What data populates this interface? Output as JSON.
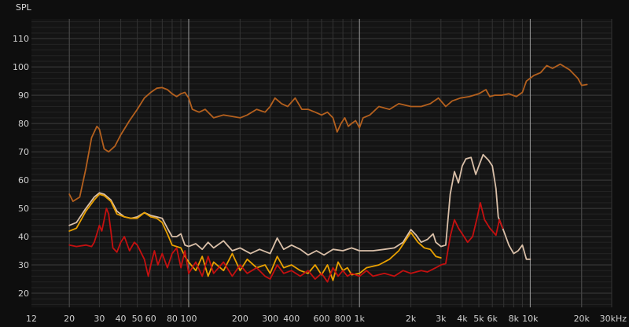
{
  "chart_data": {
    "type": "line",
    "ylabel": "SPL",
    "xscale": "log",
    "xlim": [
      12,
      30000
    ],
    "ylim": [
      15,
      117
    ],
    "grid": true,
    "yticks": [
      20,
      30,
      40,
      50,
      60,
      70,
      80,
      90,
      100,
      110
    ],
    "ytick_labels": [
      "20",
      "30",
      "40",
      "50",
      "60",
      "70",
      "80",
      "90",
      "100",
      "110"
    ],
    "xticks": [
      12,
      20,
      30,
      40,
      50,
      60,
      80,
      100,
      200,
      300,
      400,
      600,
      800,
      1000,
      2000,
      3000,
      4000,
      5000,
      6000,
      8000,
      10000,
      20000,
      30000
    ],
    "xtick_labels": [
      "12",
      "20",
      "30",
      "40",
      "50",
      "60",
      "80",
      "100",
      "200",
      "300",
      "400",
      "600",
      "800",
      "1k",
      "2k",
      "3k",
      "4k",
      "5k",
      "6k",
      "8k",
      "10k",
      "20k",
      "30kHz"
    ],
    "series": [
      {
        "color": "#b4601e",
        "points": [
          [
            20,
            55
          ],
          [
            21,
            52.5
          ],
          [
            23,
            54
          ],
          [
            25,
            64
          ],
          [
            27,
            75
          ],
          [
            29,
            79
          ],
          [
            30,
            78
          ],
          [
            32,
            71
          ],
          [
            34,
            70
          ],
          [
            37,
            72
          ],
          [
            40,
            76
          ],
          [
            45,
            81
          ],
          [
            50,
            85
          ],
          [
            55,
            89
          ],
          [
            60,
            91
          ],
          [
            65,
            92.5
          ],
          [
            70,
            92.7
          ],
          [
            75,
            92
          ],
          [
            80,
            90.5
          ],
          [
            85,
            89.5
          ],
          [
            90,
            90.5
          ],
          [
            95,
            91
          ],
          [
            100,
            89
          ],
          [
            105,
            85
          ],
          [
            115,
            84
          ],
          [
            125,
            85
          ],
          [
            140,
            82
          ],
          [
            160,
            83
          ],
          [
            180,
            82.5
          ],
          [
            200,
            82
          ],
          [
            220,
            83
          ],
          [
            250,
            85
          ],
          [
            280,
            84
          ],
          [
            300,
            86
          ],
          [
            320,
            89
          ],
          [
            350,
            87
          ],
          [
            380,
            86
          ],
          [
            420,
            89
          ],
          [
            460,
            85
          ],
          [
            500,
            85
          ],
          [
            550,
            84
          ],
          [
            600,
            83
          ],
          [
            650,
            84
          ],
          [
            700,
            82
          ],
          [
            740,
            77
          ],
          [
            780,
            80
          ],
          [
            820,
            82
          ],
          [
            860,
            79
          ],
          [
            900,
            80
          ],
          [
            950,
            81
          ],
          [
            1000,
            78.5
          ],
          [
            1050,
            82
          ],
          [
            1150,
            83
          ],
          [
            1300,
            86
          ],
          [
            1500,
            85
          ],
          [
            1700,
            87
          ],
          [
            2000,
            86
          ],
          [
            2300,
            86
          ],
          [
            2600,
            87
          ],
          [
            2900,
            89
          ],
          [
            3200,
            86
          ],
          [
            3500,
            88
          ],
          [
            3900,
            89
          ],
          [
            4400,
            89.5
          ],
          [
            5000,
            90.5
          ],
          [
            5500,
            92
          ],
          [
            5800,
            89.5
          ],
          [
            6200,
            90
          ],
          [
            6800,
            90
          ],
          [
            7500,
            90.5
          ],
          [
            8300,
            89.5
          ],
          [
            9000,
            91
          ],
          [
            9500,
            95
          ],
          [
            10500,
            97
          ],
          [
            11500,
            98
          ],
          [
            12500,
            100.5
          ],
          [
            13500,
            99.5
          ],
          [
            15000,
            101
          ],
          [
            17000,
            99
          ],
          [
            19000,
            96
          ],
          [
            20000,
            93.5
          ],
          [
            21500,
            93.8
          ]
        ]
      },
      {
        "color": "#d9bfa8",
        "points": [
          [
            20,
            44
          ],
          [
            22,
            45
          ],
          [
            25,
            50
          ],
          [
            28,
            54
          ],
          [
            30,
            55.5
          ],
          [
            32,
            55
          ],
          [
            35,
            53
          ],
          [
            38,
            49
          ],
          [
            42,
            47
          ],
          [
            46,
            46.5
          ],
          [
            50,
            47
          ],
          [
            55,
            48.5
          ],
          [
            60,
            47.5
          ],
          [
            65,
            47
          ],
          [
            70,
            46.5
          ],
          [
            75,
            43
          ],
          [
            80,
            40
          ],
          [
            85,
            40
          ],
          [
            90,
            41
          ],
          [
            95,
            37
          ],
          [
            100,
            36.5
          ],
          [
            110,
            37.5
          ],
          [
            120,
            35.5
          ],
          [
            130,
            38
          ],
          [
            140,
            36
          ],
          [
            160,
            38.5
          ],
          [
            180,
            35
          ],
          [
            200,
            36
          ],
          [
            230,
            34
          ],
          [
            260,
            35.5
          ],
          [
            300,
            34
          ],
          [
            330,
            39.5
          ],
          [
            360,
            35.5
          ],
          [
            400,
            37
          ],
          [
            450,
            35.5
          ],
          [
            500,
            33.5
          ],
          [
            560,
            35
          ],
          [
            620,
            33.5
          ],
          [
            700,
            35.5
          ],
          [
            800,
            35
          ],
          [
            900,
            36
          ],
          [
            1000,
            35
          ],
          [
            1200,
            35
          ],
          [
            1400,
            35.5
          ],
          [
            1600,
            36
          ],
          [
            1800,
            38
          ],
          [
            2000,
            42.5
          ],
          [
            2150,
            40.5
          ],
          [
            2300,
            38
          ],
          [
            2500,
            39
          ],
          [
            2700,
            41
          ],
          [
            2800,
            38
          ],
          [
            3000,
            36.5
          ],
          [
            3200,
            37
          ],
          [
            3400,
            55
          ],
          [
            3600,
            63
          ],
          [
            3800,
            59
          ],
          [
            4000,
            65
          ],
          [
            4200,
            67.5
          ],
          [
            4500,
            68
          ],
          [
            4800,
            62
          ],
          [
            5000,
            65
          ],
          [
            5300,
            69
          ],
          [
            5700,
            67
          ],
          [
            6000,
            65
          ],
          [
            6300,
            57
          ],
          [
            6500,
            47
          ],
          [
            7000,
            42
          ],
          [
            7500,
            37
          ],
          [
            8000,
            34
          ],
          [
            8500,
            35
          ],
          [
            9000,
            37
          ],
          [
            9500,
            32
          ],
          [
            10000,
            32
          ]
        ]
      },
      {
        "color": "#e8a000",
        "points": [
          [
            20,
            42
          ],
          [
            22,
            43
          ],
          [
            25,
            49
          ],
          [
            28,
            53
          ],
          [
            30,
            55
          ],
          [
            32,
            54.5
          ],
          [
            35,
            52.5
          ],
          [
            38,
            48
          ],
          [
            42,
            47
          ],
          [
            46,
            46.5
          ],
          [
            50,
            46.5
          ],
          [
            55,
            48.5
          ],
          [
            60,
            47
          ],
          [
            65,
            46.5
          ],
          [
            70,
            45
          ],
          [
            75,
            41
          ],
          [
            80,
            37
          ],
          [
            90,
            36
          ],
          [
            95,
            33
          ],
          [
            100,
            31
          ],
          [
            110,
            28
          ],
          [
            120,
            33
          ],
          [
            130,
            26
          ],
          [
            140,
            31
          ],
          [
            160,
            28
          ],
          [
            180,
            34
          ],
          [
            200,
            28
          ],
          [
            220,
            32
          ],
          [
            250,
            29
          ],
          [
            280,
            30
          ],
          [
            300,
            27
          ],
          [
            330,
            33
          ],
          [
            360,
            29
          ],
          [
            400,
            30
          ],
          [
            450,
            28
          ],
          [
            500,
            27
          ],
          [
            550,
            30
          ],
          [
            600,
            26.5
          ],
          [
            650,
            30
          ],
          [
            700,
            24.5
          ],
          [
            750,
            31
          ],
          [
            800,
            28
          ],
          [
            850,
            29
          ],
          [
            900,
            26.5
          ],
          [
            1000,
            27
          ],
          [
            1100,
            29
          ],
          [
            1300,
            30
          ],
          [
            1500,
            32
          ],
          [
            1700,
            35
          ],
          [
            2000,
            41.5
          ],
          [
            2200,
            38
          ],
          [
            2400,
            36
          ],
          [
            2600,
            35.5
          ],
          [
            2800,
            33
          ],
          [
            3000,
            32.5
          ]
        ]
      },
      {
        "color": "#c41010",
        "points": [
          [
            20,
            37
          ],
          [
            22,
            36.5
          ],
          [
            25,
            37
          ],
          [
            27,
            36.5
          ],
          [
            28,
            38
          ],
          [
            29,
            41
          ],
          [
            30,
            44
          ],
          [
            31,
            42
          ],
          [
            32,
            46
          ],
          [
            33,
            50
          ],
          [
            34,
            48
          ],
          [
            35,
            42
          ],
          [
            36,
            36
          ],
          [
            38,
            34.5
          ],
          [
            40,
            38
          ],
          [
            42,
            40
          ],
          [
            45,
            35
          ],
          [
            48,
            38
          ],
          [
            50,
            37
          ],
          [
            55,
            32
          ],
          [
            58,
            26
          ],
          [
            60,
            30
          ],
          [
            63,
            35
          ],
          [
            66,
            30
          ],
          [
            70,
            34
          ],
          [
            75,
            29
          ],
          [
            80,
            34
          ],
          [
            85,
            36
          ],
          [
            90,
            29
          ],
          [
            95,
            35
          ],
          [
            100,
            27
          ],
          [
            110,
            31
          ],
          [
            120,
            26
          ],
          [
            130,
            33
          ],
          [
            140,
            27
          ],
          [
            160,
            31
          ],
          [
            180,
            26
          ],
          [
            200,
            30
          ],
          [
            220,
            27
          ],
          [
            250,
            29
          ],
          [
            280,
            26
          ],
          [
            300,
            25
          ],
          [
            330,
            30
          ],
          [
            360,
            27
          ],
          [
            400,
            28
          ],
          [
            450,
            26
          ],
          [
            500,
            28
          ],
          [
            550,
            25
          ],
          [
            600,
            27
          ],
          [
            650,
            24
          ],
          [
            700,
            29
          ],
          [
            750,
            26
          ],
          [
            800,
            28
          ],
          [
            850,
            26
          ],
          [
            900,
            27
          ],
          [
            1000,
            26
          ],
          [
            1100,
            28
          ],
          [
            1200,
            26
          ],
          [
            1400,
            27
          ],
          [
            1600,
            26
          ],
          [
            1800,
            28
          ],
          [
            2000,
            27
          ],
          [
            2300,
            28
          ],
          [
            2500,
            27.5
          ],
          [
            2800,
            29
          ],
          [
            3000,
            30
          ],
          [
            3200,
            30.5
          ],
          [
            3400,
            40
          ],
          [
            3600,
            46
          ],
          [
            3800,
            43
          ],
          [
            4000,
            41
          ],
          [
            4300,
            38
          ],
          [
            4600,
            40
          ],
          [
            4900,
            47
          ],
          [
            5100,
            52
          ],
          [
            5400,
            46
          ],
          [
            5800,
            43
          ],
          [
            6000,
            42
          ],
          [
            6300,
            40.5
          ],
          [
            6600,
            46
          ],
          [
            6900,
            43
          ]
        ]
      }
    ]
  }
}
